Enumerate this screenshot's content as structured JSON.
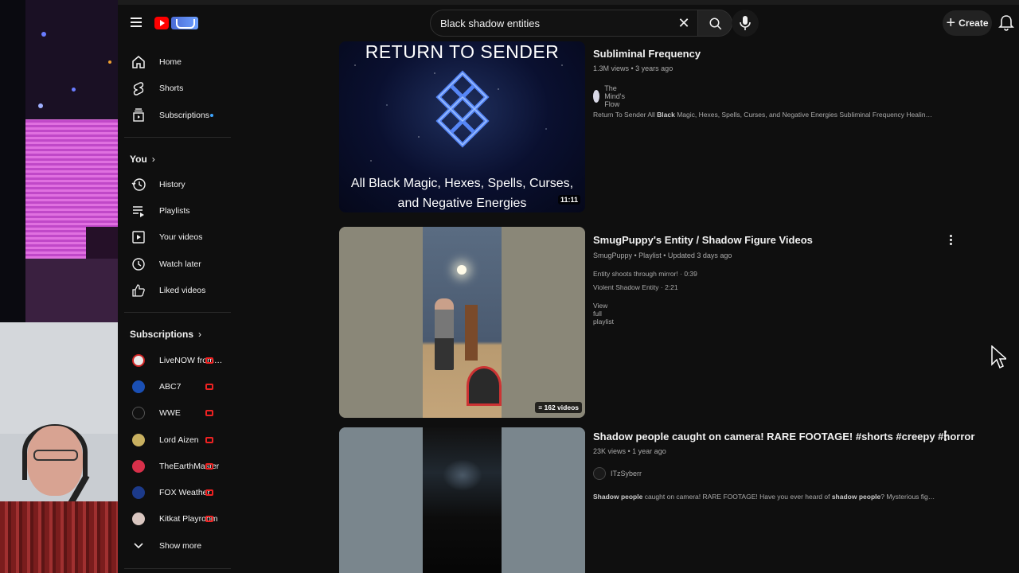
{
  "header": {
    "search_value": "Black shadow entities",
    "create_label": "Create"
  },
  "sidebar": {
    "main": [
      {
        "label": "Home",
        "icon": "home-icon"
      },
      {
        "label": "Shorts",
        "icon": "shorts-icon"
      },
      {
        "label": "Subscriptions",
        "icon": "subscriptions-icon"
      }
    ],
    "you_heading": "You",
    "you": [
      {
        "label": "History",
        "icon": "history-icon"
      },
      {
        "label": "Playlists",
        "icon": "playlists-icon"
      },
      {
        "label": "Your videos",
        "icon": "your-videos-icon"
      },
      {
        "label": "Watch later",
        "icon": "watch-later-icon"
      },
      {
        "label": "Liked videos",
        "icon": "liked-icon"
      }
    ],
    "subs_heading": "Subscriptions",
    "subs": [
      {
        "label": "LiveNOW from F...",
        "color": "#e9e9e9"
      },
      {
        "label": "ABC7",
        "color": "#1a4fb4"
      },
      {
        "label": "WWE",
        "color": "#111111"
      },
      {
        "label": "Lord Aizen",
        "color": "#c8b060"
      },
      {
        "label": "TheEarthMaster",
        "color": "#d8304a"
      },
      {
        "label": "FOX Weather",
        "color": "#1c3a8a"
      },
      {
        "label": "Kitkat Playroom",
        "color": "#d9c6c0"
      }
    ],
    "show_more": "Show more"
  },
  "results": [
    {
      "thumb_heading": "RETURN TO SENDER",
      "thumb_caption": "All Black Magic, Hexes, Spells, Curses, and Negative Energies",
      "duration": "11:11",
      "title": "Subliminal Frequency",
      "meta": "1.3M views • 3 years ago",
      "channel": "The Mind's Flow",
      "desc_parts": [
        "Return To Sender All ",
        "Black",
        " Magic, Hexes, Spells, Curses, and Negative Energies Subliminal Frequency Healing Meditation ..."
      ]
    },
    {
      "count": "162 videos",
      "title": "SmugPuppy's Entity / Shadow Figure Videos",
      "meta": "SmugPuppy • Playlist • Updated 3 days ago",
      "items": [
        "Entity shoots through mirror! · 0:39",
        "Violent Shadow Entity · 2:21"
      ],
      "full": "View full playlist"
    },
    {
      "title": "Shadow people caught on camera! RARE FOOTAGE! #shorts #creepy #horror",
      "meta": "23K views • 1 year ago",
      "channel": "ITzSyberr",
      "desc_parts": [
        "Shadow people",
        " caught on camera! RARE FOOTAGE! Have you ever heard of ",
        "shadow people",
        "? Mysterious figures that seem to ..."
      ]
    }
  ]
}
